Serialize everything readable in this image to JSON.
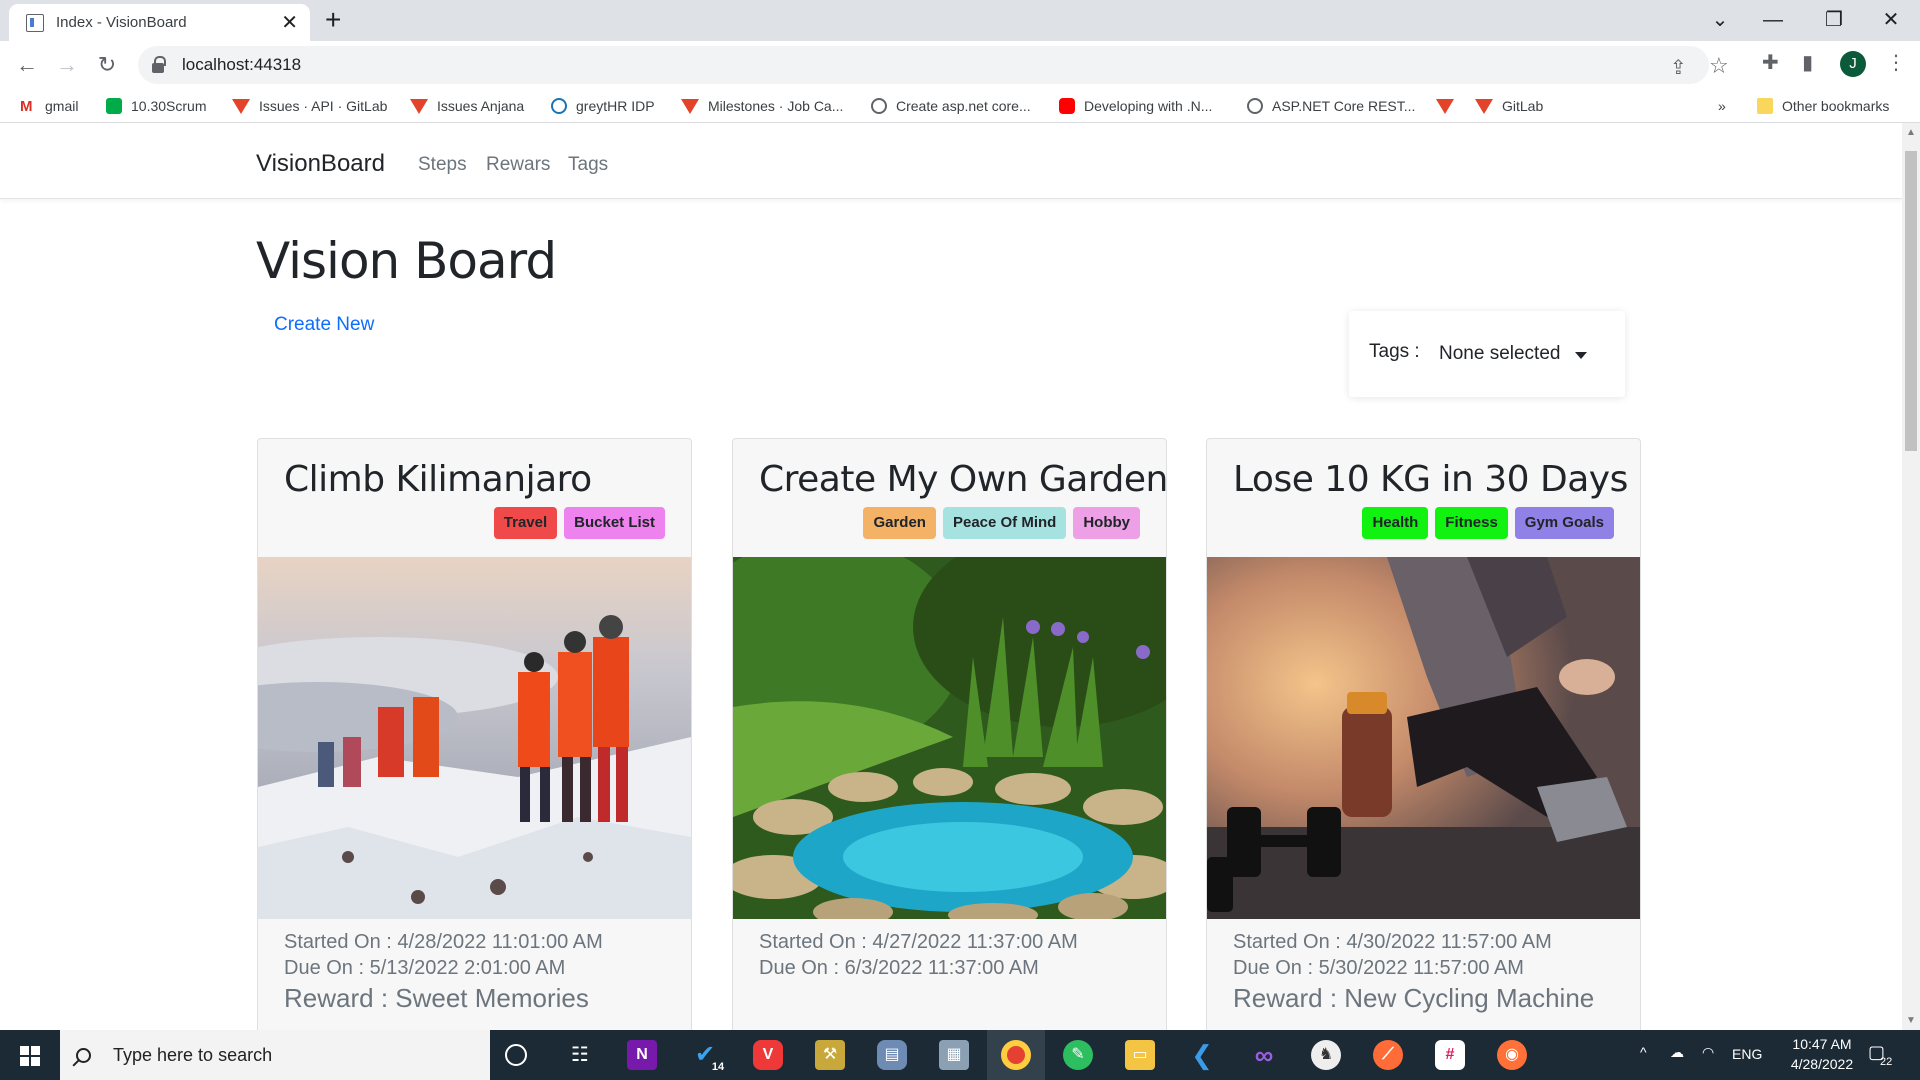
{
  "browser": {
    "tab_title": "Index - VisionBoard",
    "url": "localhost:44318",
    "profile_initial": "J",
    "bookmarks": [
      {
        "label": "gmail",
        "icon": "gmail-icon"
      },
      {
        "label": "10.30Scrum",
        "icon": "meet-icon"
      },
      {
        "label": "Issues · API · GitLab",
        "icon": "gitlab-icon"
      },
      {
        "label": "Issues Anjana",
        "icon": "gitlab-icon"
      },
      {
        "label": "greytHR IDP",
        "icon": "greythr-icon"
      },
      {
        "label": "Milestones · Job Ca...",
        "icon": "gitlab-icon"
      },
      {
        "label": "Create asp.net core...",
        "icon": "globe-icon"
      },
      {
        "label": "Developing with .N...",
        "icon": "youtube-icon"
      },
      {
        "label": "ASP.NET Core REST...",
        "icon": "globe-icon"
      },
      {
        "label": "",
        "icon": "gitlab-icon"
      },
      {
        "label": "GitLab",
        "icon": "gitlab-icon"
      }
    ],
    "more_bookmarks": "»",
    "other_bookmarks": "Other bookmarks"
  },
  "site": {
    "brand": "VisionBoard",
    "nav": [
      "Steps",
      "Rewars",
      "Tags"
    ],
    "page_title": "Vision Board",
    "create_new": "Create New",
    "tags_label": "Tags :",
    "tags_value": "None selected"
  },
  "cards": [
    {
      "title": "Climb Kilimanjaro",
      "tags": [
        {
          "label": "Travel",
          "color": "#f0494a"
        },
        {
          "label": "Bucket List",
          "color": "#ee82ee"
        }
      ],
      "image": "mountain-climbers-photo",
      "started": "Started On : 4/28/2022 11:01:00 AM",
      "due": "Due On : 5/13/2022 2:01:00 AM",
      "reward": "Reward : Sweet Memories"
    },
    {
      "title": "Create My Own Garden",
      "tags": [
        {
          "label": "Garden",
          "color": "#f4b266"
        },
        {
          "label": "Peace Of Mind",
          "color": "#a6e2e0"
        },
        {
          "label": "Hobby",
          "color": "#eea0e6"
        }
      ],
      "image": "garden-pond-photo",
      "started": "Started On : 4/27/2022 11:37:00 AM",
      "due": "Due On : 6/3/2022 11:37:00 AM",
      "reward": ""
    },
    {
      "title": "Lose 10 KG in 30 Days",
      "tags": [
        {
          "label": "Health",
          "color": "#11f211"
        },
        {
          "label": "Fitness",
          "color": "#11f211"
        },
        {
          "label": "Gym Goals",
          "color": "#8f81e6"
        }
      ],
      "image": "gym-workout-photo",
      "started": "Started On : 4/30/2022 11:57:00 AM",
      "due": "Due On : 5/30/2022 11:57:00 AM",
      "reward": "Reward : New Cycling Machine"
    }
  ],
  "taskbar": {
    "search_placeholder": "Type here to search",
    "todo_badge": "14",
    "language": "ENG",
    "time": "10:47 AM",
    "date": "4/28/2022",
    "notification_count": "22"
  }
}
